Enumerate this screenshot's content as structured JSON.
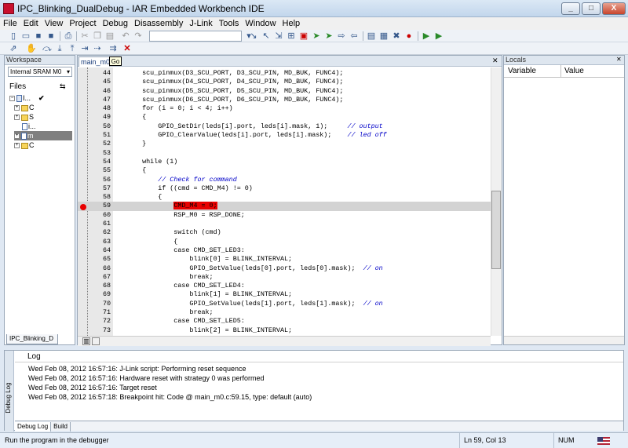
{
  "window": {
    "title": "IPC_Blinking_DualDebug - IAR Embedded Workbench IDE",
    "min": "_",
    "max": "□",
    "close": "X"
  },
  "menu": [
    "File",
    "Edit",
    "View",
    "Project",
    "Debug",
    "Disassembly",
    "J-Link",
    "Tools",
    "Window",
    "Help"
  ],
  "toolbar": {
    "icons": [
      "new-file",
      "open",
      "save",
      "save-all",
      "print",
      "cut",
      "copy",
      "paste",
      "undo",
      "redo",
      "find",
      "go-to",
      "bookmark",
      "compile",
      "make",
      "debug",
      "stop",
      "breakpoint",
      "step-over",
      "step-into",
      "run",
      "go"
    ]
  },
  "workspace": {
    "title": "Workspace",
    "config": "Internal SRAM M0",
    "files_header": "Files",
    "tree": [
      {
        "label": "I...",
        "type": "project",
        "check": "✔"
      },
      {
        "label": "C",
        "type": "folder"
      },
      {
        "label": "S",
        "type": "folder"
      },
      {
        "label": "i...",
        "type": "file"
      },
      {
        "label": "m",
        "type": "file"
      },
      {
        "label": "C",
        "type": "folder"
      }
    ],
    "tab": "IPC_Blinking_D"
  },
  "editor": {
    "tab": "main_m0.c",
    "tooltip": "Go",
    "lines": [
      {
        "n": "44",
        "code": "    scu_pinmux(D3_SCU_PORT, D3_SCU_PIN, MD_BUK, FUNC4);",
        "comment": ""
      },
      {
        "n": "45",
        "code": "    scu_pinmux(D4_SCU_PORT, D4_SCU_PIN, MD_BUK, FUNC4);",
        "comment": ""
      },
      {
        "n": "46",
        "code": "    scu_pinmux(D5_SCU_PORT, D5_SCU_PIN, MD_BUK, FUNC4);",
        "comment": ""
      },
      {
        "n": "47",
        "code": "    scu_pinmux(D6_SCU_PORT, D6_SCU_PIN, MD_BUK, FUNC4);",
        "comment": ""
      },
      {
        "n": "48",
        "code": "    for (i = 0; i < 4; i++)",
        "comment": ""
      },
      {
        "n": "49",
        "code": "    {",
        "comment": ""
      },
      {
        "n": "50",
        "code": "        GPIO_SetDir(leds[i].port, leds[i].mask, 1);     ",
        "comment": "// output"
      },
      {
        "n": "51",
        "code": "        GPIO_ClearValue(leds[i].port, leds[i].mask);    ",
        "comment": "// led off"
      },
      {
        "n": "52",
        "code": "    }",
        "comment": ""
      },
      {
        "n": "53",
        "code": "",
        "comment": ""
      },
      {
        "n": "54",
        "code": "    while (1)",
        "comment": ""
      },
      {
        "n": "55",
        "code": "    {",
        "comment": ""
      },
      {
        "n": "56",
        "code": "        ",
        "comment": "// Check for command"
      },
      {
        "n": "57",
        "code": "        if ((cmd = CMD_M4) != 0)",
        "comment": ""
      },
      {
        "n": "58",
        "code": "        {",
        "comment": ""
      },
      {
        "n": "59",
        "code": "            ",
        "comment": "",
        "hl": "CMD_M4 = 0;"
      },
      {
        "n": "60",
        "code": "            RSP_M0 = RSP_DONE;",
        "comment": ""
      },
      {
        "n": "61",
        "code": "",
        "comment": ""
      },
      {
        "n": "62",
        "code": "            switch (cmd)",
        "comment": ""
      },
      {
        "n": "63",
        "code": "            {",
        "comment": ""
      },
      {
        "n": "64",
        "code": "            case CMD_SET_LED3:",
        "comment": ""
      },
      {
        "n": "65",
        "code": "                blink[0] = BLINK_INTERVAL;",
        "comment": ""
      },
      {
        "n": "66",
        "code": "                GPIO_SetValue(leds[0].port, leds[0].mask);  ",
        "comment": "// on"
      },
      {
        "n": "67",
        "code": "                break;",
        "comment": ""
      },
      {
        "n": "68",
        "code": "            case CMD_SET_LED4:",
        "comment": ""
      },
      {
        "n": "69",
        "code": "                blink[1] = BLINK_INTERVAL;",
        "comment": ""
      },
      {
        "n": "70",
        "code": "                GPIO_SetValue(leds[1].port, leds[1].mask);  ",
        "comment": "// on"
      },
      {
        "n": "71",
        "code": "                break;",
        "comment": ""
      },
      {
        "n": "72",
        "code": "            case CMD_SET_LED5:",
        "comment": ""
      },
      {
        "n": "73",
        "code": "                blink[2] = BLINK_INTERVAL;",
        "comment": ""
      }
    ]
  },
  "locals": {
    "title": "Locals",
    "col_variable": "Variable",
    "col_value": "Value"
  },
  "log": {
    "side_label": "Debug Log",
    "header": "Log",
    "entries": [
      "Wed Feb 08, 2012 16:57:16: J-Link script: Performing reset sequence",
      "Wed Feb 08, 2012 16:57:16: Hardware reset with strategy 0 was performed",
      "Wed Feb 08, 2012 16:57:16: Target reset",
      "Wed Feb 08, 2012 16:57:18: Breakpoint hit: Code @ main_m0.c:59.15, type: default (auto)"
    ],
    "tabs": [
      "Debug Log",
      "Build"
    ]
  },
  "status": {
    "message": "Run the program in the debugger",
    "position": "Ln 59, Col 13",
    "num": "NUM"
  }
}
